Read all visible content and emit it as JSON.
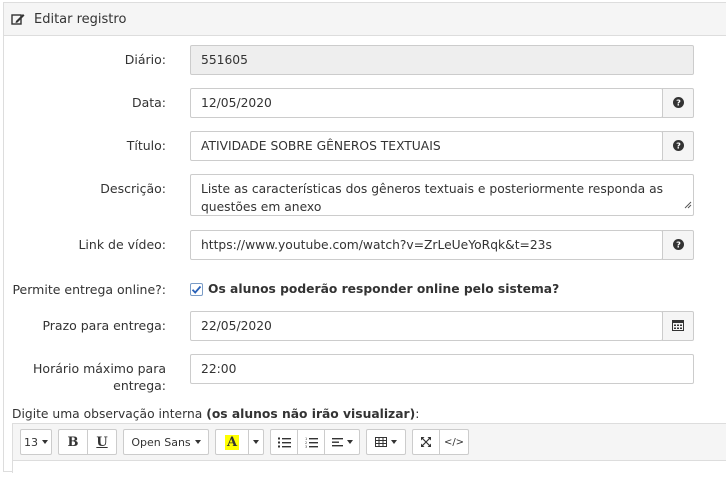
{
  "header": {
    "title": "Editar registro",
    "icon": "edit-icon"
  },
  "form": {
    "diario": {
      "label": "Diário:",
      "value": "551605"
    },
    "data": {
      "label": "Data:",
      "value": "12/05/2020",
      "icon": "question-circle-icon"
    },
    "titulo": {
      "label": "Título:",
      "value": "ATIVIDADE SOBRE GÊNEROS TEXTUAIS",
      "icon": "question-circle-icon"
    },
    "descricao": {
      "label": "Descrição:",
      "value": "Liste as características dos gêneros textuais e posteriormente responda as questões em anexo"
    },
    "link_video": {
      "label": "Link de vídeo:",
      "value": "https://www.youtube.com/watch?v=ZrLeUeYoRqk&t=23s",
      "icon": "question-circle-icon"
    },
    "entrega_online": {
      "label": "Permite entrega online?:",
      "checked": true,
      "text": "Os alunos poderão responder online pelo sistema?"
    },
    "prazo": {
      "label": "Prazo para entrega:",
      "value": "22/05/2020",
      "icon": "calendar-icon"
    },
    "horario": {
      "label_line1": "Horário máximo para",
      "label_line2": "entrega:",
      "value": "22:00"
    }
  },
  "note": {
    "prefix": "Digite uma observação interna ",
    "bold": "(os alunos não irão visualizar)",
    "suffix": ":"
  },
  "editor": {
    "font_size": "13",
    "bold": "B",
    "underline": "U",
    "font_family": "Open Sans",
    "highlight": "A",
    "highlight_color": "#ffff00",
    "code": "</>"
  }
}
